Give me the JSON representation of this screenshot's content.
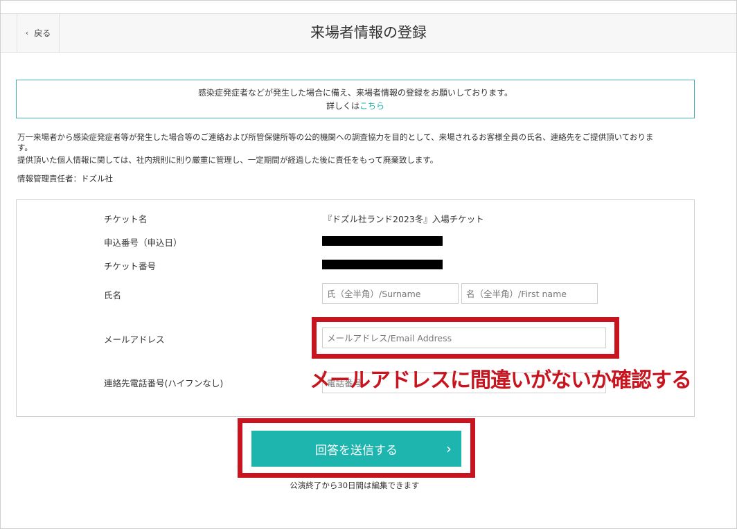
{
  "header": {
    "back_label": "戻る",
    "title": "来場者情報の登録"
  },
  "notice": {
    "line1": "感染症発症者などが発生した場合に備え、来場者情報の登録をお願いしております。",
    "line2_prefix": "詳しくは",
    "line2_link": "こちら"
  },
  "description": {
    "p1_a": "万一来場者から感染症発症者等が発生した場合等のご連絡および所管保健所等の公的機関への調査協力を目的として、来場されるお客様全員の氏名、連絡先をご提供頂いておりま",
    "p1_b": "す。",
    "p2": "提供頂いた個人情報に関しては、社内規則に則り厳重に管理し、一定期間が経過した後に責任をもって廃棄致します。",
    "p3": "情報管理責任者：ドズル社"
  },
  "form": {
    "ticket_name_label": "チケット名",
    "ticket_name_value": "『ドズル社ランド2023冬』入場チケット",
    "order_no_label": "申込番号（申込日）",
    "ticket_no_label": "チケット番号",
    "name_label": "氏名",
    "surname_placeholder": "氏（全半角）/Surname",
    "firstname_placeholder": "名（全半角）/First name",
    "email_label": "メールアドレス",
    "email_placeholder": "メールアドレス/Email Address",
    "phone_label": "連絡先電話番号(ハイフンなし)",
    "phone_placeholder": "電話番号"
  },
  "annotation": {
    "caption": "メールアドレスに間違いがないか確認する",
    "color": "#c8141e"
  },
  "submit": {
    "label": "回答を送信する",
    "arrow": "›",
    "color": "#1db5ad"
  },
  "footnote": "公演終了から30日間は編集できます"
}
